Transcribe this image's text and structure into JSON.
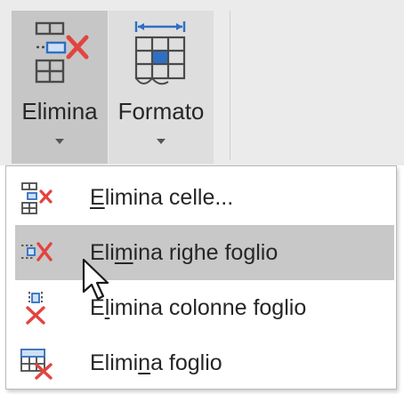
{
  "ribbon": {
    "delete_button": {
      "label": "Elimina",
      "icon": "delete-cells-icon"
    },
    "format_button": {
      "label": "Formato",
      "icon": "format-cells-icon"
    }
  },
  "menu": {
    "items": [
      {
        "pre": "",
        "key": "E",
        "post": "limina celle...",
        "icon": "delete-cells-small-icon",
        "hover": false
      },
      {
        "pre": "Eli",
        "key": "m",
        "post": "ina righe foglio",
        "icon": "delete-rows-icon",
        "hover": true
      },
      {
        "pre": "E",
        "key": "l",
        "post": "imina colonne foglio",
        "icon": "delete-columns-icon",
        "hover": false
      },
      {
        "pre": "Elimi",
        "key": "n",
        "post": "a foglio",
        "icon": "delete-sheet-icon",
        "hover": false
      }
    ]
  },
  "colors": {
    "delete_red": "#e2443f",
    "accent_blue": "#2e6fc4",
    "hover_bg": "#c8c8c8"
  }
}
